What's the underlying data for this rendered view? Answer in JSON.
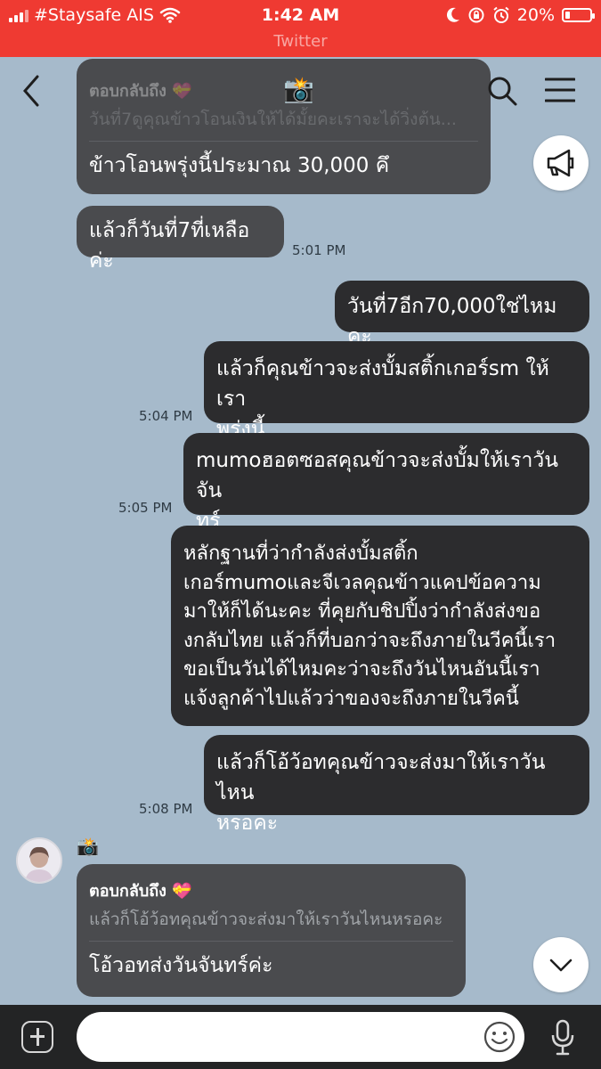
{
  "status_bar": {
    "carrier": "#Staysafe AIS",
    "time": "1:42 AM",
    "battery": "20%",
    "battery_level": 0.2,
    "subtitle": "Twitter"
  },
  "header": {
    "title_icon": "📸"
  },
  "messages": [
    {
      "id": "m1",
      "reply_label": "ตอบกลับถึง 💝",
      "reply_quote": "วันที่7ดูคุณข้าวโอนเงินให้ได้มั้ยคะเราจะได้วิ่งต้น...",
      "text": "ข้าวโอนพรุ่งนี้ประมาณ 30,000 คึ"
    },
    {
      "id": "m2",
      "text": "แล้วก็วันที่7ที่เหลือค่ะ",
      "time": "5:01 PM"
    },
    {
      "id": "m3",
      "text": "วันที่7อีก70,000ใช่ไหมคะ"
    },
    {
      "id": "m4",
      "lines": [
        "แล้วก็คุณข้าวจะส่งบั้มสติ้กเกอร์sm ให้เรา",
        "พรุ่งนี้"
      ],
      "time": "5:04 PM"
    },
    {
      "id": "m5",
      "lines": [
        "mumoฮอตซอสคุณข้าวจะส่งบั้มให้เราวันจัน",
        "ทร์"
      ],
      "time": "5:05 PM"
    },
    {
      "id": "m6",
      "lines": [
        "หลักฐานที่ว่ากำลังส่งบั้มสติ้ก",
        "เกอร์mumoและจีเวลคุณข้าวแคปข้อความ",
        "มาให้ก็ได้นะคะ ที่คุยกับชิปปิ้งว่ากำลังส่งขอ",
        "งกลับไทย แล้วก็ที่บอกว่าจะถึงภายในวีคนี้เรา",
        "ขอเป็นวันได้ไหมคะว่าจะถึงวันไหนอันนี้เรา",
        "แจ้งลูกค้าไปแล้วว่าของจะถึงภายในวีคนี้"
      ]
    },
    {
      "id": "m7",
      "lines": [
        "แล้วก็โอ้ว้อทคุณข้าวจะส่งมาให้เราวันไหน",
        "หรอคะ"
      ],
      "time": "5:08 PM"
    },
    {
      "id": "m8",
      "sender_icon": "📸",
      "reply_label": "ตอบกลับถึง 💝",
      "reply_quote": "แล้วก็โอ้ว้อทคุณข้าวจะส่งมาให้เราวันไหนหรอคะ",
      "text": "โอ้วอทส่งวันจันทร์ค่ะ"
    }
  ],
  "input": {
    "placeholder": ""
  },
  "icons": {
    "back": "chevron-left-icon",
    "search": "search-icon",
    "menu": "hamburger-menu-icon",
    "announce": "megaphone-icon",
    "scroll_down": "chevron-down-icon",
    "add": "plus-icon",
    "emoji": "smiley-icon",
    "mic": "microphone-icon"
  },
  "colors": {
    "status_bar": "#ef3a32",
    "chat_background": "#a6bacb",
    "incoming_bubble": "#4a4b4e",
    "outgoing_bubble": "#2c2c2e",
    "input_bar": "#232425"
  }
}
